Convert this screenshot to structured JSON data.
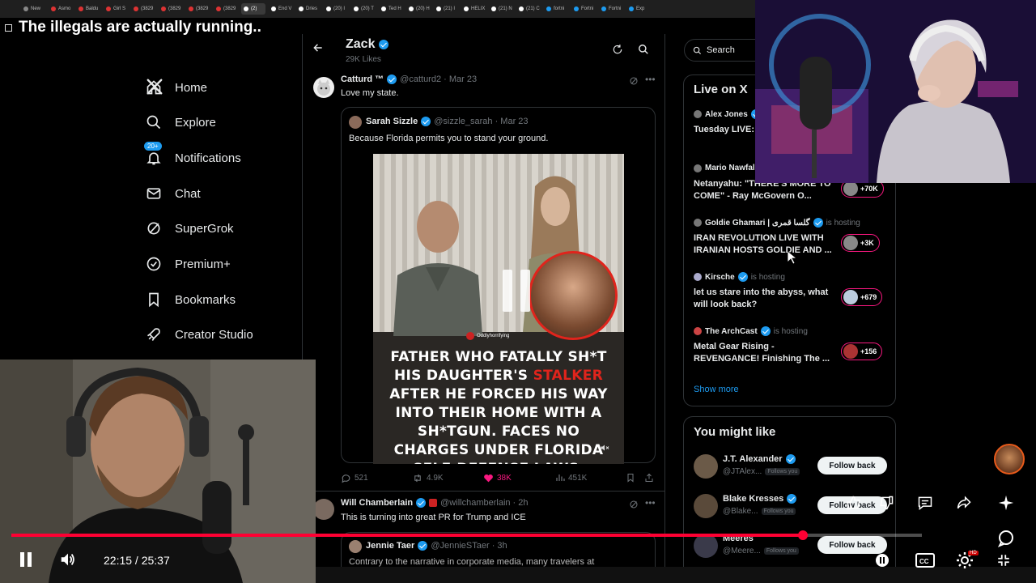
{
  "browser": {
    "tabs": [
      {
        "label": "New",
        "color": "#888"
      },
      {
        "label": "Asmo",
        "color": "#d33"
      },
      {
        "label": "Baldu",
        "color": "#d33"
      },
      {
        "label": "Girl S",
        "color": "#d33"
      },
      {
        "label": "(3829",
        "color": "#d33"
      },
      {
        "label": "(3829",
        "color": "#d33"
      },
      {
        "label": "(3829",
        "color": "#d33"
      },
      {
        "label": "(3829",
        "color": "#d33"
      },
      {
        "label": "(2)",
        "color": "#fff",
        "active": true
      },
      {
        "label": "End V",
        "color": "#fff"
      },
      {
        "label": "Dries",
        "color": "#fff"
      },
      {
        "label": "(20) I",
        "color": "#fff"
      },
      {
        "label": "(20) T",
        "color": "#fff"
      },
      {
        "label": "Ted H",
        "color": "#fff"
      },
      {
        "label": "(20) H",
        "color": "#fff"
      },
      {
        "label": "(21) I",
        "color": "#fff"
      },
      {
        "label": "HELIX",
        "color": "#fff"
      },
      {
        "label": "(21) N",
        "color": "#fff"
      },
      {
        "label": "(21) C",
        "color": "#fff"
      },
      {
        "label": "fortni",
        "color": "#1d9bf0"
      },
      {
        "label": "Fortni",
        "color": "#1d9bf0"
      },
      {
        "label": "Fortni",
        "color": "#1d9bf0"
      },
      {
        "label": "Exp",
        "color": "#1d9bf0"
      }
    ]
  },
  "video": {
    "title": "The illegals are actually running..",
    "time": "22:15 / 25:37",
    "progress": 0.869
  },
  "nav": {
    "items": [
      {
        "label": "Home",
        "icon": "home-icon"
      },
      {
        "label": "Explore",
        "icon": "search-icon"
      },
      {
        "label": "Notifications",
        "icon": "bell-icon",
        "badge": "20+"
      },
      {
        "label": "Chat",
        "icon": "mail-icon"
      },
      {
        "label": "SuperGrok",
        "icon": "grok-icon"
      },
      {
        "label": "Premium+",
        "icon": "verified-icon"
      },
      {
        "label": "Bookmarks",
        "icon": "bookmark-icon"
      },
      {
        "label": "Creator Studio",
        "icon": "rocket-icon"
      }
    ]
  },
  "profile": {
    "name": "Zack",
    "likes": "29K Likes"
  },
  "tweet1": {
    "name": "Catturd ™",
    "handle": "@catturd2 · Mar 23",
    "text": "Love my state."
  },
  "quote": {
    "name": "Sarah Sizzle",
    "handle": "@sizzle_sarah · Mar 23",
    "text": "Because Florida permits you to stand your ground.",
    "credit": "Oddlyhorrifying",
    "caption_pre": "FATHER WHO FATALLY SH*T HIS DAUGHTER'S ",
    "caption_red": "STALKER",
    "caption_post": " AFTER HE FORCED HIS WAY INTO THEIR HOME WITH A SH*TGUN. FACES NO CHARGES UNDER FLORIDA SELF-DEFENSE LAWS."
  },
  "actions": {
    "replies": "521",
    "reposts": "4.9K",
    "likes": "38K",
    "views": "451K"
  },
  "tweet2": {
    "name": "Will Chamberlain",
    "handle": "@willchamberlain · 2h",
    "text": "This is turning into great PR for Trump and ICE"
  },
  "quote2": {
    "name": "Jennie Taer",
    "handle": "@JennieSTaer · 3h",
    "text": "Contrary to the narrative in corporate media, many travelers at"
  },
  "sidebar": {
    "search_placeholder": "Search",
    "live_title": "Live on X",
    "live": [
      {
        "host": "Alex Jones",
        "hosting": "",
        "desc": "Tuesday LIVE: Missiles Hit Is",
        "count": ""
      },
      {
        "host": "Mario Nawfal",
        "hosting": "",
        "desc": "Netanyahu: \"THERE'S MORE TO COME\" - Ray McGovern O...",
        "count": "+70K"
      },
      {
        "host": "Goldie Ghamari | گلسا قمری",
        "hosting": "is hosting",
        "desc": "IRAN REVOLUTION LIVE WITH IRANIAN HOSTS GOLDIE AND ...",
        "count": "+3K"
      },
      {
        "host": "Kirsche",
        "hosting": "is hosting",
        "desc": "let us stare into the abyss, what will look back?",
        "count": "+679"
      },
      {
        "host": "The ArchCast",
        "hosting": "is hosting",
        "desc": "Metal Gear Rising - REVENGANCE! Finishing The ...",
        "count": "+156"
      }
    ],
    "show_more": "Show more",
    "wtf_title": "You might like",
    "wtf": [
      {
        "name": "J.T. Alexander",
        "handle": "@JTAlex...",
        "follows": "Follows you",
        "button": "Follow back"
      },
      {
        "name": "Blake Kresses",
        "handle": "@Blake...",
        "follows": "Follows you",
        "button": "Follow back"
      },
      {
        "name": "Meeres",
        "handle": "@Meere...",
        "follows": "Follows you",
        "button": "Follow back"
      }
    ]
  },
  "colors": {
    "accent": "#1d9bf0",
    "like": "#f91880",
    "progress": "#ff0033"
  }
}
